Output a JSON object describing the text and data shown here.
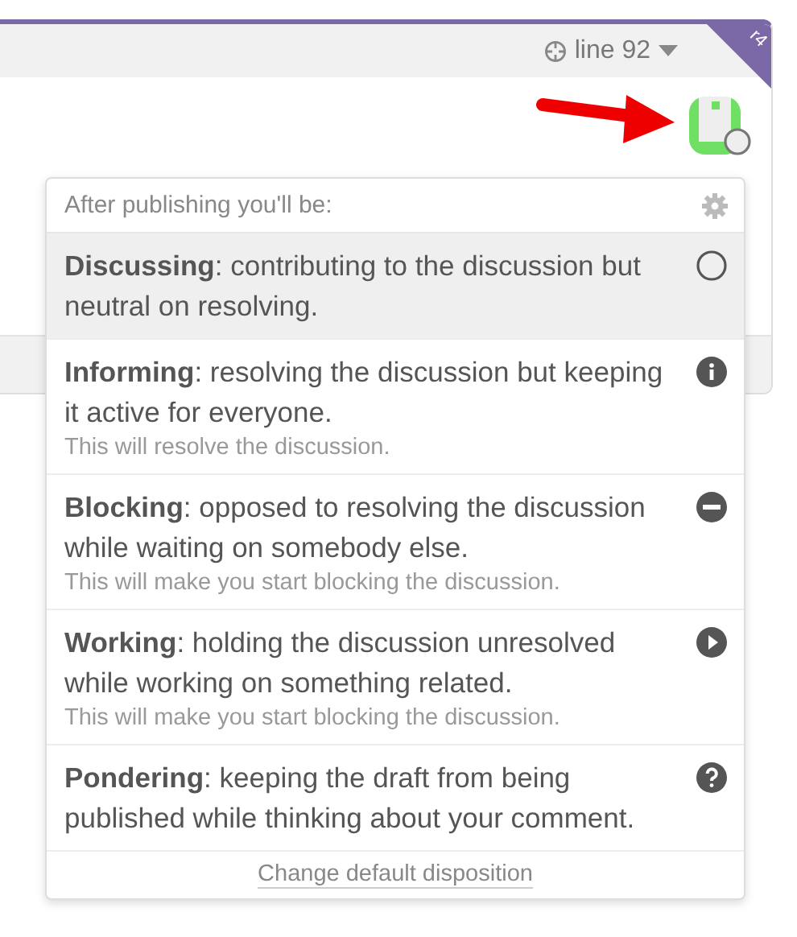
{
  "comment_header": {
    "location": "line 92",
    "revision": "r4"
  },
  "avatar": {
    "status_ring": true
  },
  "disposition_menu": {
    "title": "After publishing you'll be:",
    "options": [
      {
        "kind": "discussing",
        "text": "**Discussing**: contributing to the discussion but neutral on resolving.",
        "selected": true
      },
      {
        "kind": "informing",
        "text": "**Informing**: resolving the discussion but keeping it active for everyone.",
        "note": "This will resolve the discussion.",
        "selected": false
      },
      {
        "kind": "blocking",
        "text": "**Blocking**: opposed to resolving the discussion while waiting on somebody else.",
        "note": "This will make you start blocking the discussion.",
        "selected": false
      },
      {
        "kind": "working",
        "text": "**Working**: holding the discussion unresolved while working on something related.",
        "note": "This will make you start blocking the discussion.",
        "selected": false
      },
      {
        "kind": "pondering",
        "text": "**Pondering**: keeping the draft from being published while thinking about your comment.",
        "selected": false
      }
    ],
    "footer_link": "Change default disposition"
  }
}
